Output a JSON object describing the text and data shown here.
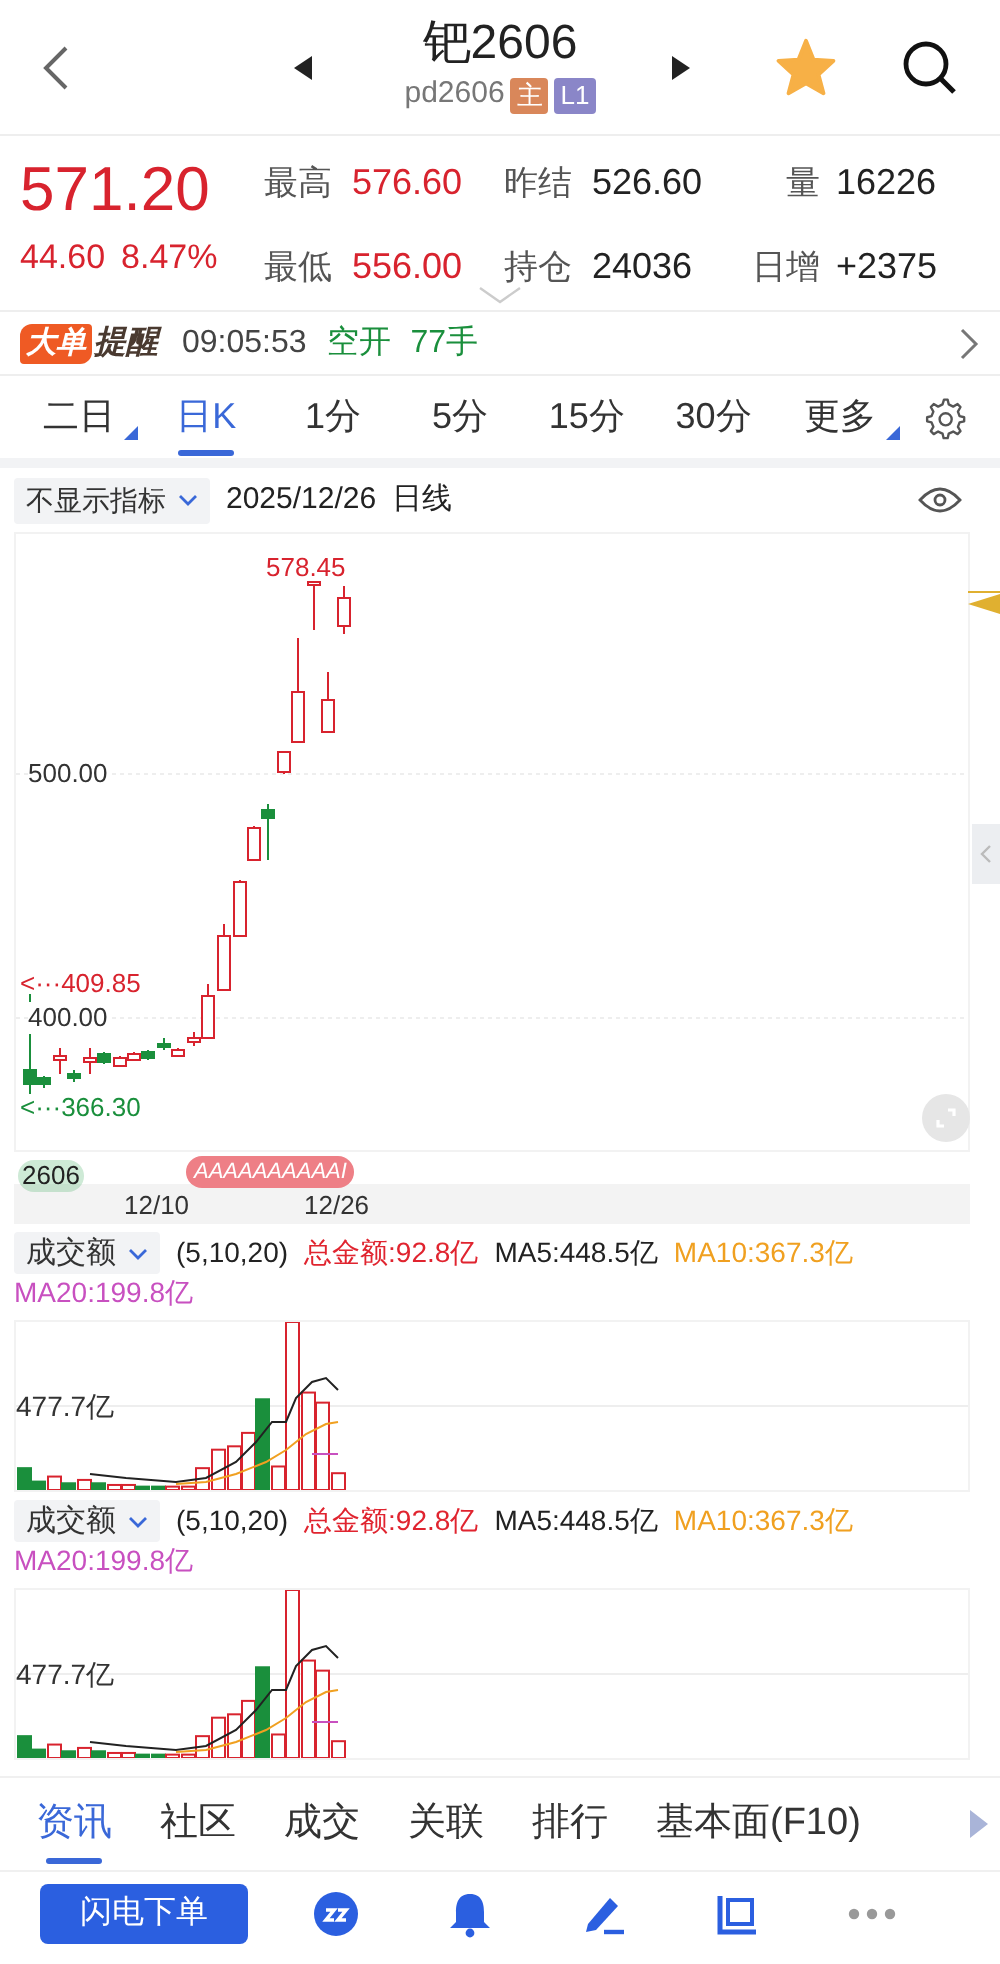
{
  "header": {
    "title": "钯2606",
    "code": "pd2606",
    "favorited": true,
    "tags": [
      {
        "text": "主",
        "color": "#d9875a"
      },
      {
        "text": "L1",
        "color": "#8a86c8"
      }
    ]
  },
  "quote": {
    "price": "571.20",
    "change": "44.60",
    "change_pct": "8.47%",
    "stats": [
      {
        "label": "最高",
        "value": "576.60",
        "rising": true
      },
      {
        "label": "昨结",
        "value": "526.60",
        "rising": false
      },
      {
        "label": "量",
        "value": "16226",
        "rising": false
      },
      {
        "label": "最低",
        "value": "556.00",
        "rising": true
      },
      {
        "label": "持仓",
        "value": "24036",
        "rising": false
      },
      {
        "label": "日增",
        "value": "+2375",
        "rising": false
      }
    ]
  },
  "alert": {
    "badge": "大单",
    "title": "提醒",
    "time": "09:05:53",
    "action": "空开",
    "quantity": "77手"
  },
  "periods": [
    {
      "label": "二日",
      "selected": false,
      "dropdown": true
    },
    {
      "label": "日K",
      "selected": true,
      "dropdown": false
    },
    {
      "label": "1分",
      "selected": false,
      "dropdown": false
    },
    {
      "label": "5分",
      "selected": false,
      "dropdown": false
    },
    {
      "label": "15分",
      "selected": false,
      "dropdown": false
    },
    {
      "label": "30分",
      "selected": false,
      "dropdown": false
    },
    {
      "label": "更多",
      "selected": false,
      "dropdown": true
    }
  ],
  "chart_toolbar": {
    "indicator": "不显示指标",
    "date": "2025/12/26",
    "chart_type": "日线"
  },
  "main_chart": {
    "high_label": "578.45",
    "y_ticks": [
      "500.00",
      "400.00"
    ],
    "range_high": "<···409.85",
    "range_low": "<···366.30",
    "contract": "2606",
    "signal_badge": "AAAAAAAAAAI",
    "x_labels": [
      "12/10",
      "12/26"
    ]
  },
  "volume_panels": [
    {
      "selector": "成交额",
      "params": "(5,10,20)",
      "axis_label": "477.7亿",
      "legend": [
        {
          "text": "总金额:92.8亿",
          "color": "#e0242f"
        },
        {
          "text": "MA5:448.5亿",
          "color": "#222222"
        },
        {
          "text": "MA10:367.3亿",
          "color": "#f0a020"
        },
        {
          "text": "MA20:199.8亿",
          "color": "#c850c0"
        }
      ]
    },
    {
      "selector": "成交额",
      "params": "(5,10,20)",
      "axis_label": "477.7亿",
      "legend": [
        {
          "text": "总金额:92.8亿",
          "color": "#e0242f"
        },
        {
          "text": "MA5:448.5亿",
          "color": "#222222"
        },
        {
          "text": "MA10:367.3亿",
          "color": "#f0a020"
        },
        {
          "text": "MA20:199.8亿",
          "color": "#c850c0"
        }
      ]
    }
  ],
  "bottom_tabs": [
    {
      "label": "资讯",
      "selected": true
    },
    {
      "label": "社区",
      "selected": false
    },
    {
      "label": "成交",
      "selected": false
    },
    {
      "label": "关联",
      "selected": false
    },
    {
      "label": "排行",
      "selected": false
    },
    {
      "label": "基本面(F10)",
      "selected": false
    }
  ],
  "action_bar": {
    "button": "闪电下单"
  }
}
